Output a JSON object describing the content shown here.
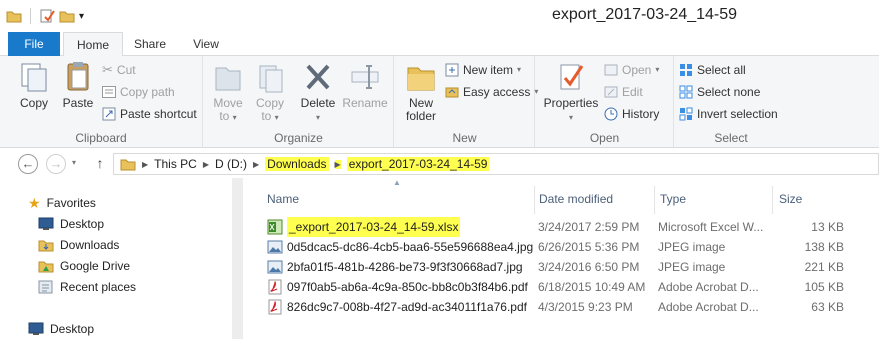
{
  "window": {
    "title": "export_2017-03-24_14-59"
  },
  "tabs": {
    "file": "File",
    "home": "Home",
    "share": "Share",
    "view": "View"
  },
  "ribbon": {
    "clipboard": {
      "label": "Clipboard",
      "copy": "Copy",
      "paste": "Paste",
      "cut": "Cut",
      "copy_path": "Copy path",
      "paste_shortcut": "Paste shortcut"
    },
    "organize": {
      "label": "Organize",
      "move_to": [
        "Move",
        "to"
      ],
      "copy_to": [
        "Copy",
        "to"
      ],
      "delete": "Delete",
      "rename": "Rename"
    },
    "new": {
      "label": "New",
      "new_folder": [
        "New",
        "folder"
      ],
      "new_item": "New item",
      "easy_access": "Easy access"
    },
    "open": {
      "label": "Open",
      "properties": "Properties",
      "open": "Open",
      "edit": "Edit",
      "history": "History"
    },
    "select": {
      "label": "Select",
      "select_all": "Select all",
      "select_none": "Select none",
      "invert": "Invert selection"
    }
  },
  "address": {
    "crumbs": [
      "This PC",
      "D (D:)",
      "Downloads",
      "export_2017-03-24_14-59"
    ]
  },
  "nav": {
    "favorites": "Favorites",
    "desktop": "Desktop",
    "downloads": "Downloads",
    "google_drive": "Google Drive",
    "recent": "Recent places",
    "desktop_root": "Desktop"
  },
  "columns": {
    "name": "Name",
    "date": "Date modified",
    "type": "Type",
    "size": "Size"
  },
  "files": [
    {
      "name": "_export_2017-03-24_14-59.xlsx",
      "date": "3/24/2017 2:59 PM",
      "type": "Microsoft Excel W...",
      "size": "13 KB",
      "icon": "excel-icon"
    },
    {
      "name": "0d5dcac5-dc86-4cb5-baa6-55e596688ea4.jpg",
      "date": "6/26/2015 5:36 PM",
      "type": "JPEG image",
      "size": "138 KB",
      "icon": "image-icon"
    },
    {
      "name": "2bfa01f5-481b-4286-be73-9f3f30668ad7.jpg",
      "date": "3/24/2016 6:50 PM",
      "type": "JPEG image",
      "size": "221 KB",
      "icon": "image-icon"
    },
    {
      "name": "097f0ab5-ab6a-4c9a-850c-bb8c0b3f84b6.pdf",
      "date": "6/18/2015 10:49 AM",
      "type": "Adobe Acrobat D...",
      "size": "105 KB",
      "icon": "pdf-icon"
    },
    {
      "name": "826dc9c7-008b-4f27-ad9d-ac34011f1a76.pdf",
      "date": "4/3/2015 9:23 PM",
      "type": "Adobe Acrobat D...",
      "size": "63 KB",
      "icon": "pdf-icon"
    }
  ],
  "colors": {
    "accent": "#1979ca",
    "highlight": "#ffff50",
    "folder": "#e8c15a"
  }
}
